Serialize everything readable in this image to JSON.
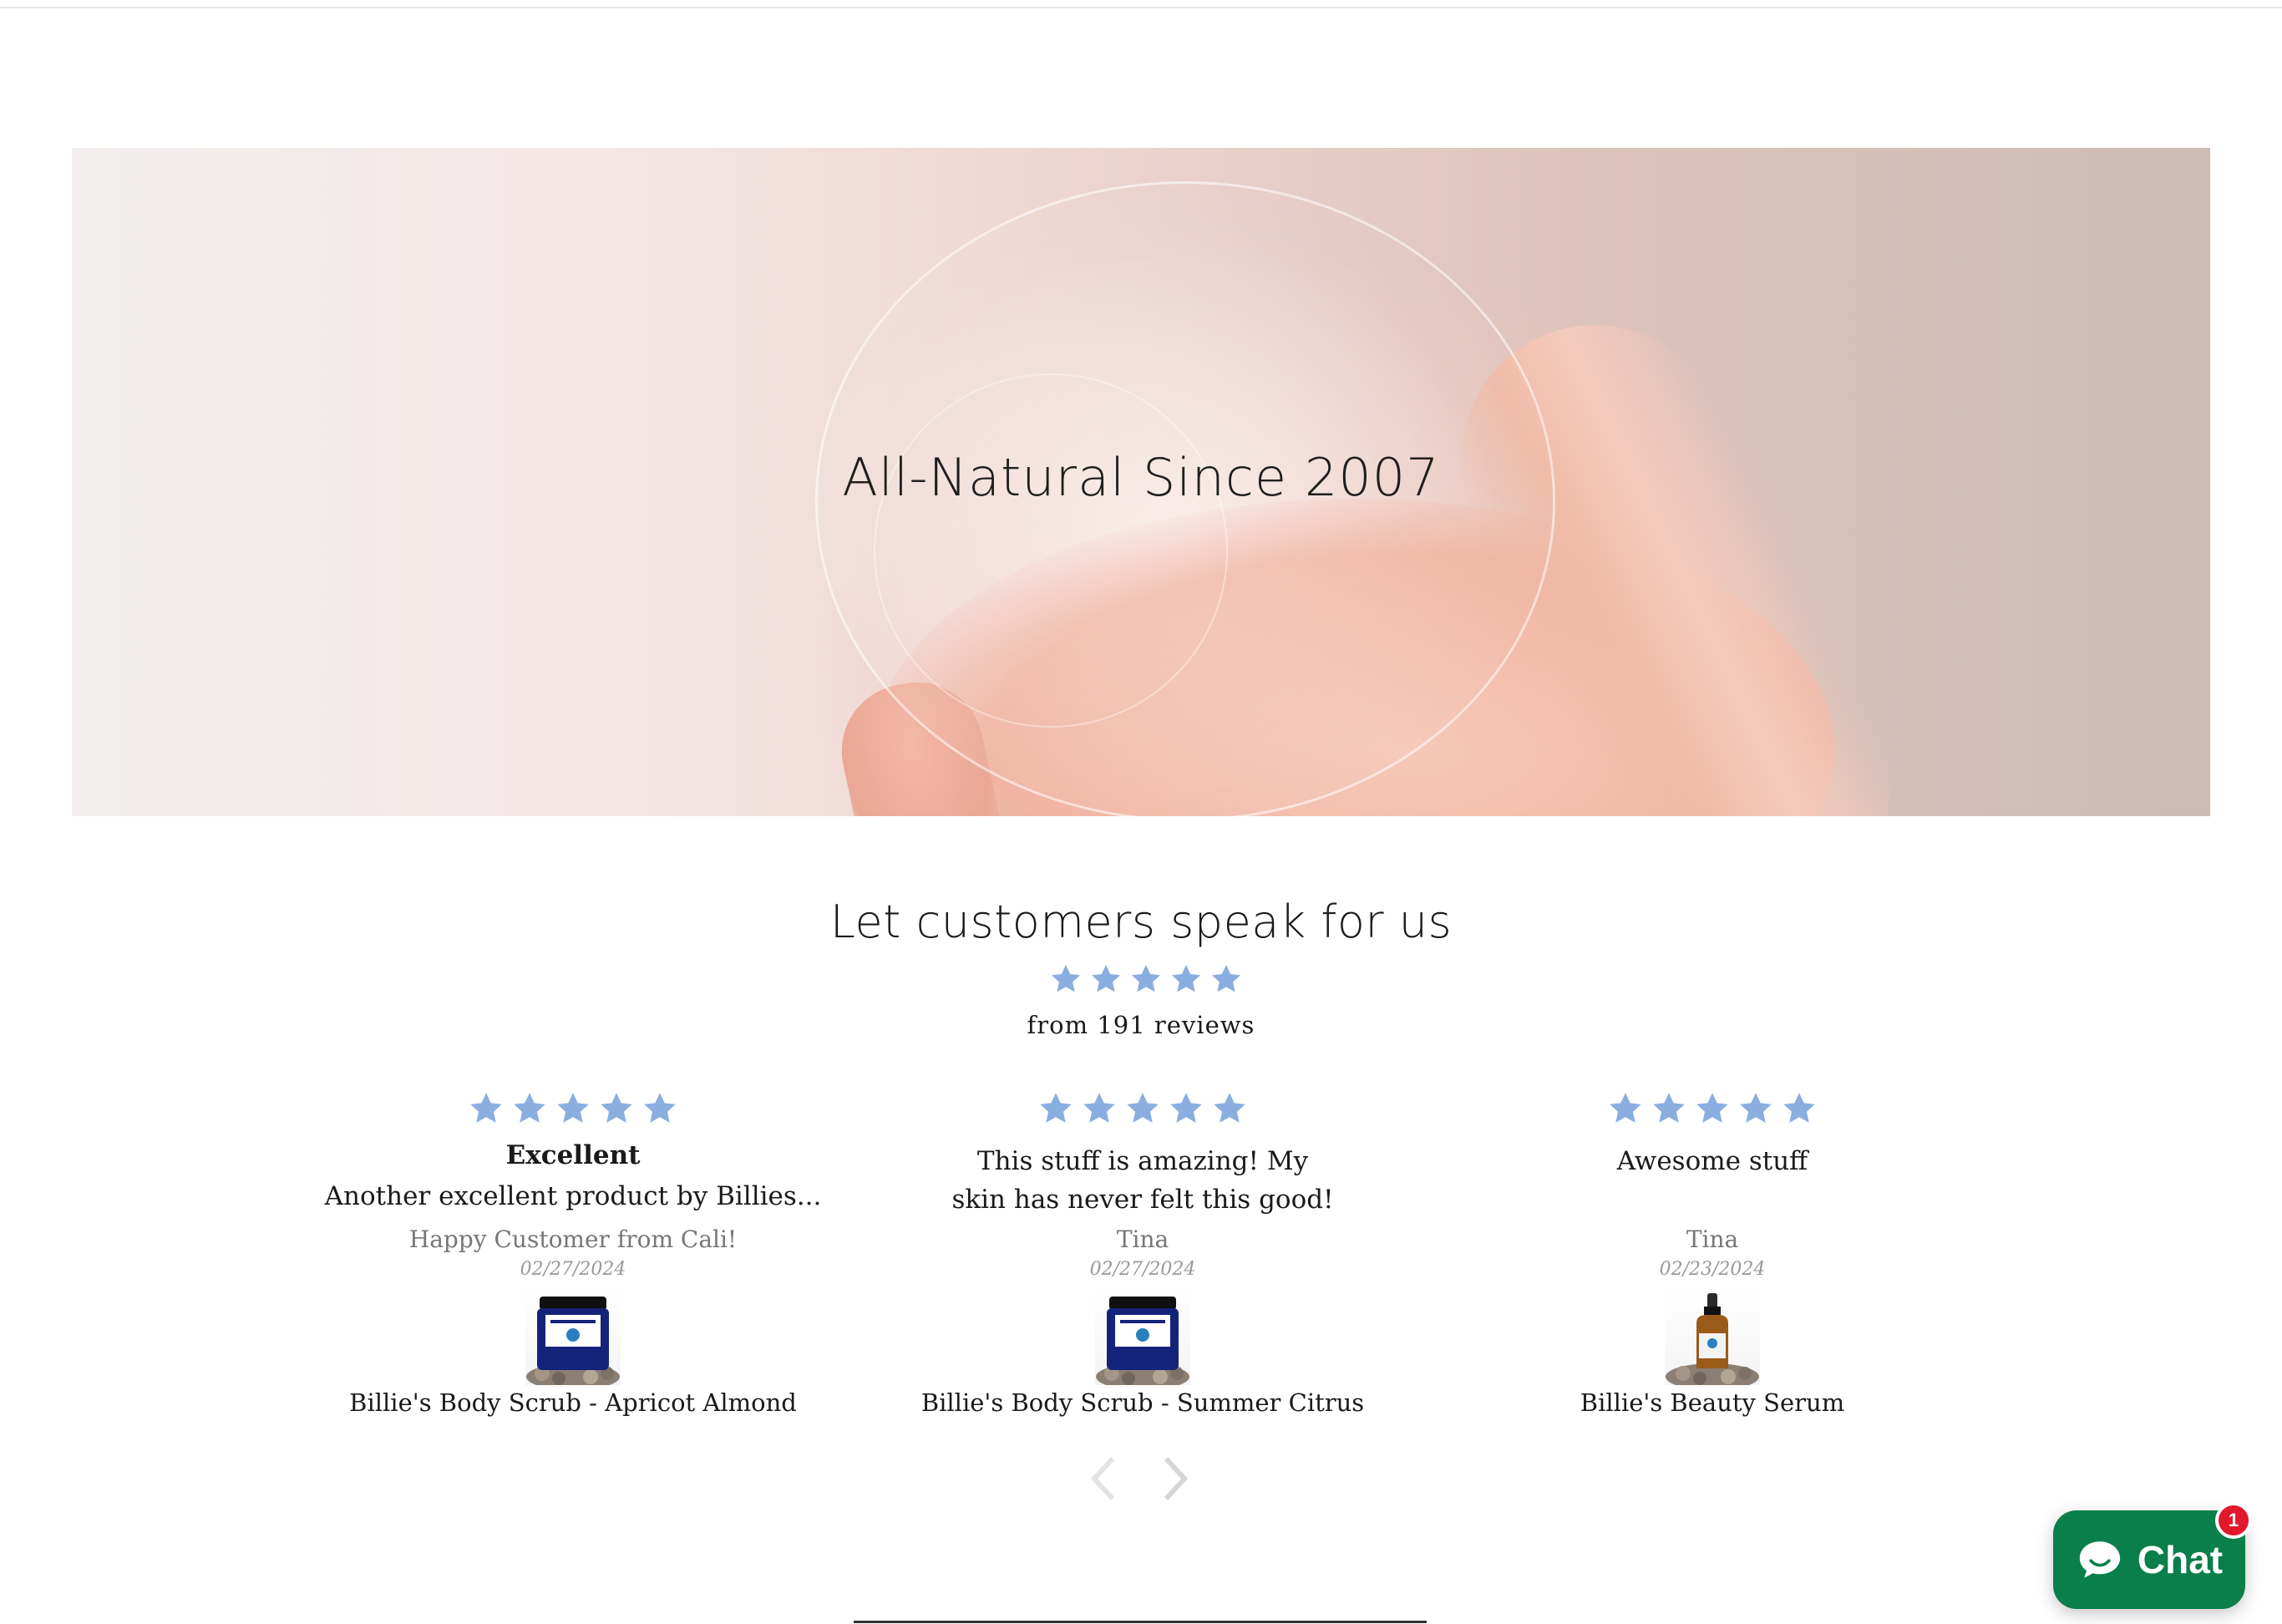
{
  "hero": {
    "title": "All-Natural Since 2007"
  },
  "reviews": {
    "heading": "Let customers speak for us",
    "rating_stars": 5,
    "summary": "from 191 reviews",
    "star_color": "#8aaee0",
    "items": [
      {
        "stars": 5,
        "title": "Excellent",
        "body": "Another excellent product by Billies...",
        "author": "Happy Customer from Cali!",
        "date": "02/27/2024",
        "product_image": "blue-jar-product-image",
        "product": "Billie's Body Scrub - Apricot Almond"
      },
      {
        "stars": 5,
        "title": "",
        "body": "This stuff is amazing! My skin has never felt this good!",
        "author": "Tina",
        "date": "02/27/2024",
        "product_image": "blue-jar-product-image",
        "product": "Billie's Body Scrub - Summer Citrus"
      },
      {
        "stars": 5,
        "title": "",
        "body": "Awesome stuff",
        "author": "Tina",
        "date": "02/23/2024",
        "product_image": "serum-bottle-product-image",
        "product": "Billie's Beauty Serum"
      }
    ],
    "prev_icon": "chevron-left-icon",
    "next_icon": "chevron-right-icon"
  },
  "chat": {
    "label": "Chat",
    "badge_count": "1",
    "color": "#0a7f4a",
    "badge_color": "#e2182b"
  }
}
